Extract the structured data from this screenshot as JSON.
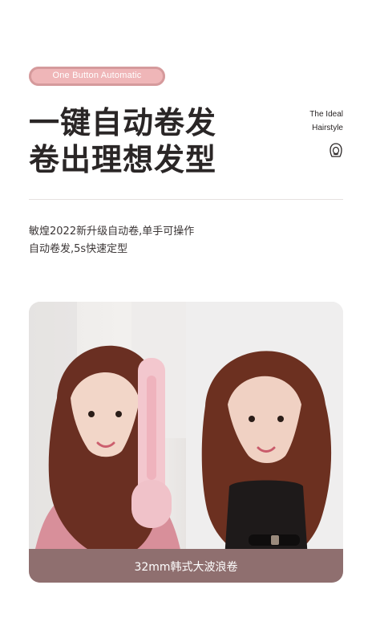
{
  "badge": {
    "label": "One Button Automatic"
  },
  "headline": {
    "line1": "一键自动卷发",
    "line2": "卷出理想发型"
  },
  "side_note": {
    "line1": "The Ideal",
    "line2": "Hairstyle",
    "icon": "hair-icon"
  },
  "description": {
    "line1": "敏煌2022新升级自动卷,单手可操作",
    "line2": "自动卷发,5s快速定型"
  },
  "photo": {
    "caption": "32mm韩式大波浪卷",
    "caption_bar_color": "#8f6f6f"
  },
  "colors": {
    "badge_bg": "#efb6b8",
    "badge_border": "#d59a9c",
    "text": "#2a2626",
    "divider": "#e6e1df"
  }
}
